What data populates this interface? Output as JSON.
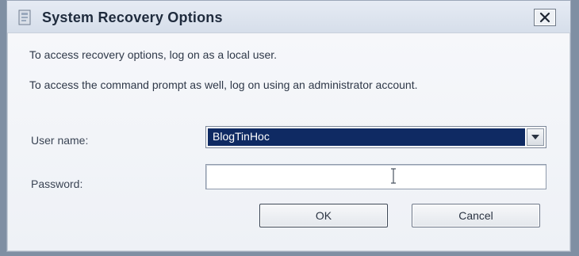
{
  "window": {
    "title": "System Recovery Options"
  },
  "messages": {
    "line1": "To access recovery options, log on as a local user.",
    "line2": "To access the command prompt as well, log on using an administrator account."
  },
  "form": {
    "user_label": "User name:",
    "user_value": "BlogTinHoc",
    "password_label": "Password:",
    "password_value": ""
  },
  "buttons": {
    "ok": "OK",
    "cancel": "Cancel"
  },
  "icons": {
    "title": "recovery-app-icon",
    "close": "close-icon",
    "dropdown": "chevron-down-icon",
    "cursor": "text-cursor-icon"
  },
  "colors": {
    "selection": "#0f2a63",
    "window_bg": "#f0f2f6"
  }
}
